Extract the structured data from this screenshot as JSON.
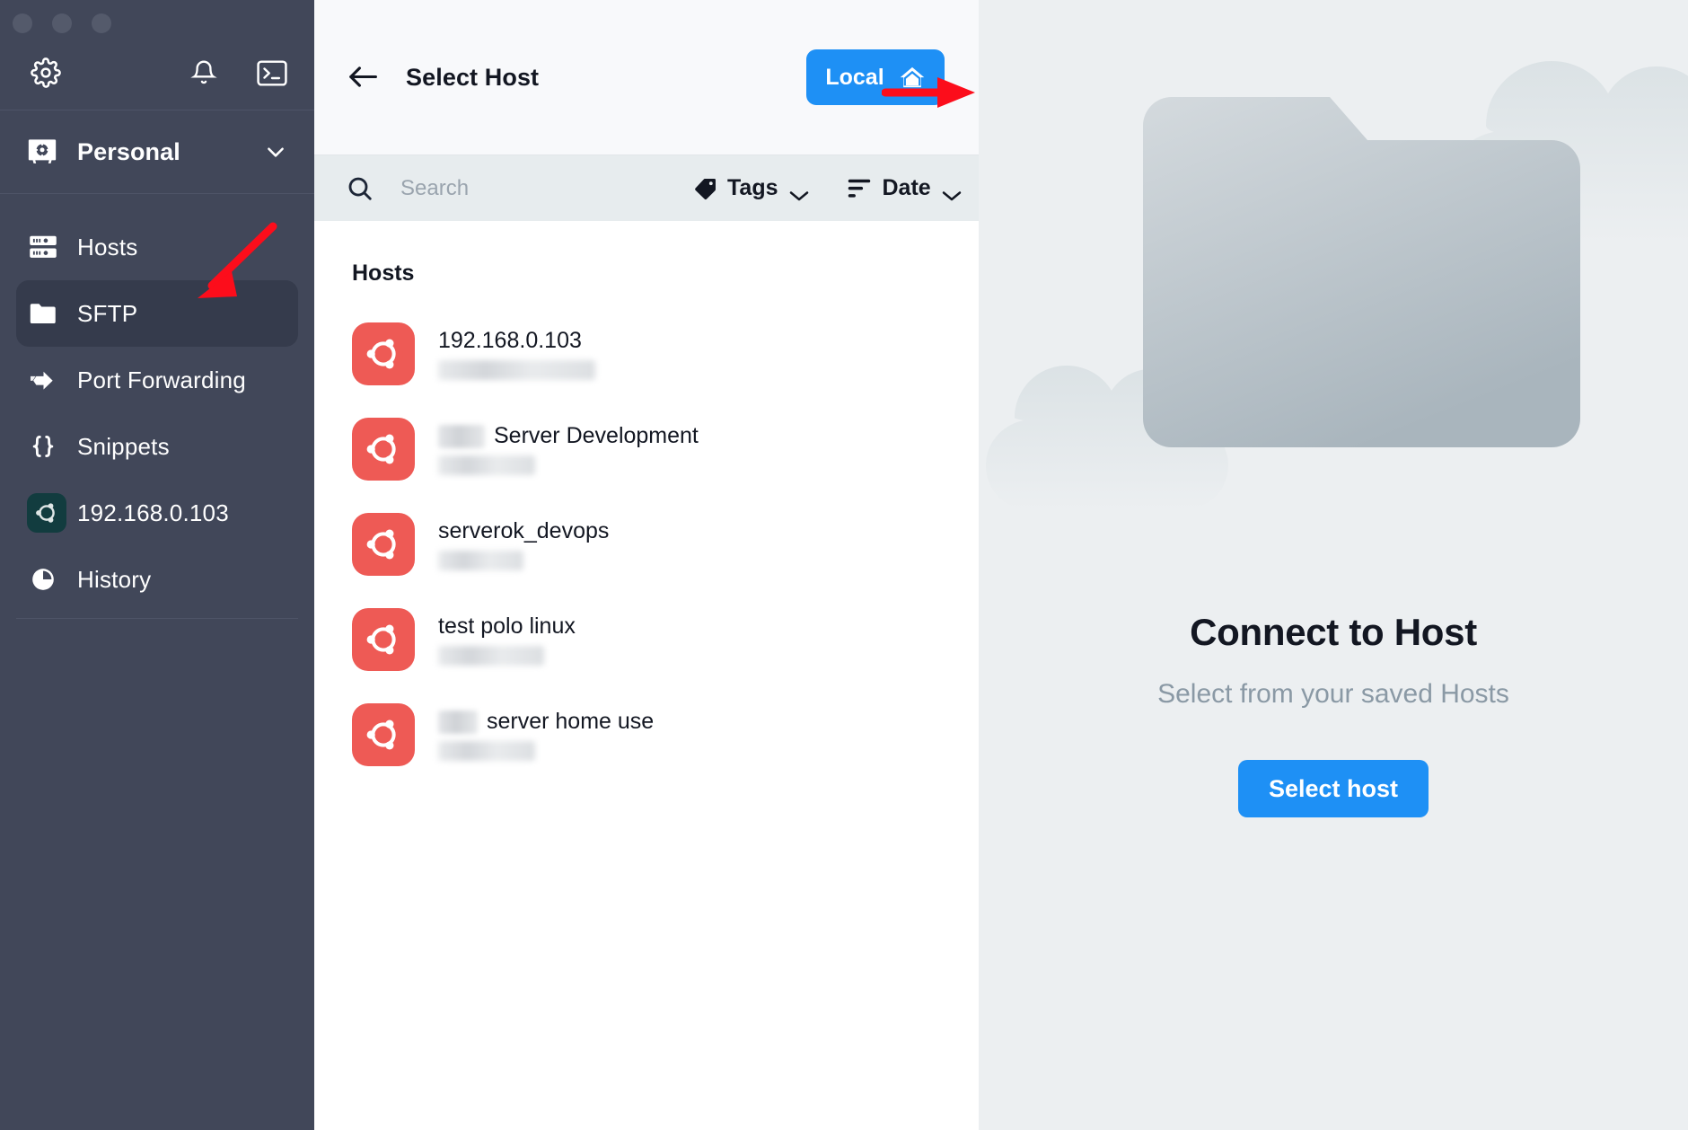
{
  "window": {
    "traffic_lights": [
      "close",
      "minimize",
      "maximize"
    ]
  },
  "sidebar": {
    "tools": [
      {
        "name": "settings",
        "icon": "gear-icon"
      },
      {
        "name": "notifications",
        "icon": "bell-icon"
      },
      {
        "name": "terminal",
        "icon": "terminal-icon"
      }
    ],
    "vault": {
      "label": "Personal",
      "icon": "vault-icon",
      "chevron": "chevron-down-icon"
    },
    "items": [
      {
        "label": "Hosts",
        "icon": "server-icon",
        "active": false
      },
      {
        "label": "SFTP",
        "icon": "folder-icon",
        "active": true
      },
      {
        "label": "Port Forwarding",
        "icon": "arrow-right-icon",
        "active": false
      },
      {
        "label": "Snippets",
        "icon": "braces-icon",
        "active": false
      },
      {
        "label": "192.168.0.103",
        "icon": "ubuntu-icon",
        "active": false
      },
      {
        "label": "History",
        "icon": "clock-icon",
        "active": false
      }
    ]
  },
  "middle": {
    "header": {
      "back_icon": "arrow-left-icon",
      "title": "Select Host",
      "local_button": {
        "label": "Local",
        "icon": "house-icon"
      }
    },
    "filters": {
      "search_icon": "search-icon",
      "search_placeholder": "Search",
      "search_value": "",
      "tags": {
        "label": "Tags",
        "icon": "tag-icon",
        "chevron": "chevron-down-icon"
      },
      "date": {
        "label": "Date",
        "icon": "sort-icon",
        "chevron": "chevron-down-icon"
      }
    },
    "list": {
      "section_title": "Hosts",
      "hosts": [
        {
          "name": "192.168.0.103",
          "name_prefix_redacted": false,
          "prefix_width": 0,
          "sub_redacted": true,
          "sub_width": 175,
          "icon": "ubuntu-icon"
        },
        {
          "name": "Server Development",
          "name_prefix_redacted": true,
          "prefix_width": 52,
          "sub_redacted": true,
          "sub_width": 108,
          "icon": "ubuntu-icon"
        },
        {
          "name": "serverok_devops",
          "name_prefix_redacted": false,
          "prefix_width": 0,
          "sub_redacted": true,
          "sub_width": 95,
          "icon": "ubuntu-icon"
        },
        {
          "name": "test polo linux",
          "name_prefix_redacted": false,
          "prefix_width": 0,
          "sub_redacted": true,
          "sub_width": 118,
          "icon": "ubuntu-icon"
        },
        {
          "name": "server home use",
          "name_prefix_redacted": true,
          "prefix_width": 44,
          "sub_redacted": true,
          "sub_width": 108,
          "icon": "ubuntu-icon"
        }
      ]
    }
  },
  "right_panel": {
    "illustration": "folder-clouds-illustration",
    "title": "Connect to Host",
    "subtitle": "Select from your saved Hosts",
    "button_label": "Select host"
  },
  "annotations": [
    {
      "name": "arrow-to-sftp",
      "color": "#fc0d1b",
      "points_at": "SFTP"
    },
    {
      "name": "arrow-to-local-button",
      "color": "#fc0d1b",
      "points_at": "Local"
    },
    {
      "name": "arrow-to-select-host-button",
      "color": "#fc0d1b",
      "points_at": "Select host"
    }
  ],
  "colors": {
    "sidebar_bg": "#414759",
    "sidebar_active": "#353b4c",
    "accent_blue": "#1e90f5",
    "ubuntu_red": "#ee5a55",
    "ubuntu_dark": "#123c3f",
    "right_bg": "#eceff1",
    "filterbar_bg": "#e7ecee",
    "annotation_red": "#fc0d1b"
  }
}
